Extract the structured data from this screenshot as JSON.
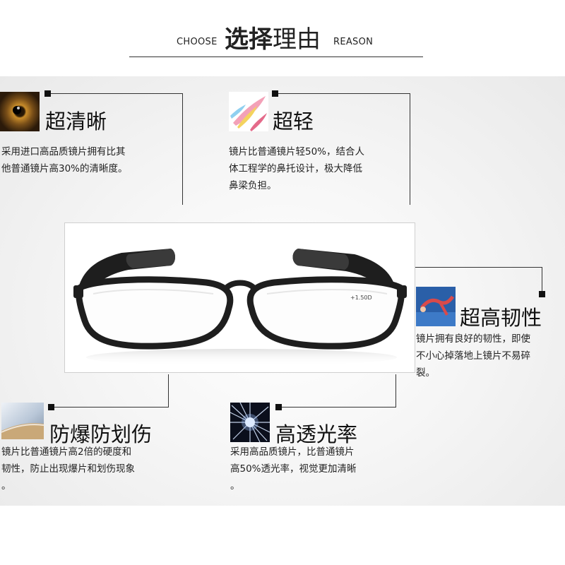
{
  "header": {
    "choose": "CHOOSE",
    "title_bold": "选择",
    "title_light": "理由",
    "reason": "REASON"
  },
  "features": {
    "clarity": {
      "title": "超清晰",
      "desc_line1": "采用进口高品质镜片拥有比其",
      "desc_line2": "他普通镜片高30%的清晰度。",
      "icon": "eye-icon"
    },
    "light": {
      "title": "超轻",
      "desc_line1": "镜片比普通镜片轻50%，结合人",
      "desc_line2": "体工程学的鼻托设计，极大降低",
      "desc_line3": "鼻梁负担。",
      "icon": "feather-icon"
    },
    "toughness": {
      "title": "超高韧性",
      "desc_line1": "镜片拥有良好的韧性，即使",
      "desc_line2": "不小心掉落地上镜片不易碎",
      "desc_line3": "裂。",
      "icon": "gymnast-icon"
    },
    "explosion_proof": {
      "title": "防爆防划伤",
      "desc_line1": "镜片比普通镜片高2倍的硬度和",
      "desc_line2": "韧性，防止出现爆片和划伤现象",
      "desc_line3": "。",
      "icon": "lens-edge-icon"
    },
    "transmittance": {
      "title": "高透光率",
      "desc_line1": "采用高品质镜片，比普通镜片",
      "desc_line2": "高50%透光率，视觉更加清晰",
      "desc_line3": "。",
      "icon": "starburst-icon"
    }
  },
  "product": {
    "lens_label": "+1.50D"
  },
  "colors": {
    "line": "#333333",
    "frame": "#1e1e1e"
  }
}
